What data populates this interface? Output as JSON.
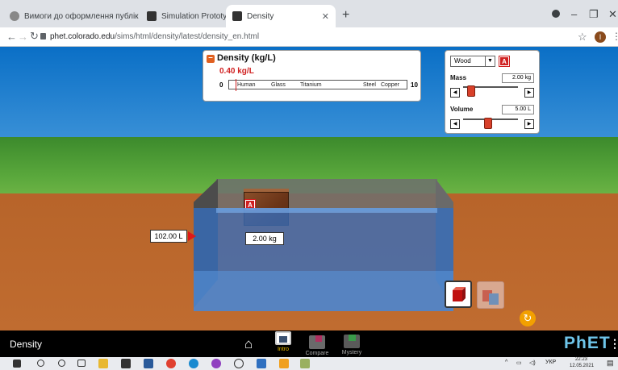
{
  "browser": {
    "tabs": [
      {
        "title": "Вимоги до оформлення публік",
        "active": false
      },
      {
        "title": "Simulation Prototypes",
        "active": false
      },
      {
        "title": "Density",
        "active": true
      }
    ],
    "new_tab": "+",
    "url_host": "phet.colorado.edu",
    "url_path": "/sims/html/density/latest/density_en.html",
    "profile_initial": "I",
    "window_controls": [
      "–",
      "❐",
      "✕"
    ]
  },
  "density_panel": {
    "title": "Density (kg/L)",
    "value": "0.40 kg/L",
    "min": "0",
    "max": "10",
    "materials": [
      "Human",
      "Glass",
      "Titanium",
      "Steel",
      "Copper"
    ]
  },
  "controls": {
    "material": "Wood",
    "badge": "A",
    "mass_label": "Mass",
    "mass_value": "2.00 kg",
    "mass_fraction": 0.15,
    "volume_label": "Volume",
    "volume_value": "5.00 L",
    "volume_fraction": 0.45
  },
  "scene": {
    "block_badge": "A",
    "block_mass": "2.00 kg",
    "pool_volume": "102.00 L"
  },
  "navbar": {
    "sim_title": "Density",
    "screens": [
      {
        "label": "Intro",
        "active": true
      },
      {
        "label": "Compare",
        "active": false
      },
      {
        "label": "Mystery",
        "active": false
      }
    ],
    "logo": "PhET"
  },
  "taskbar": {
    "lang": "УКР",
    "time": "22:23",
    "date": "12.05.2021"
  },
  "colors": {
    "accent_red": "#d02020",
    "phet_blue": "#6ec5ea",
    "intro_yellow": "#f0c000"
  }
}
